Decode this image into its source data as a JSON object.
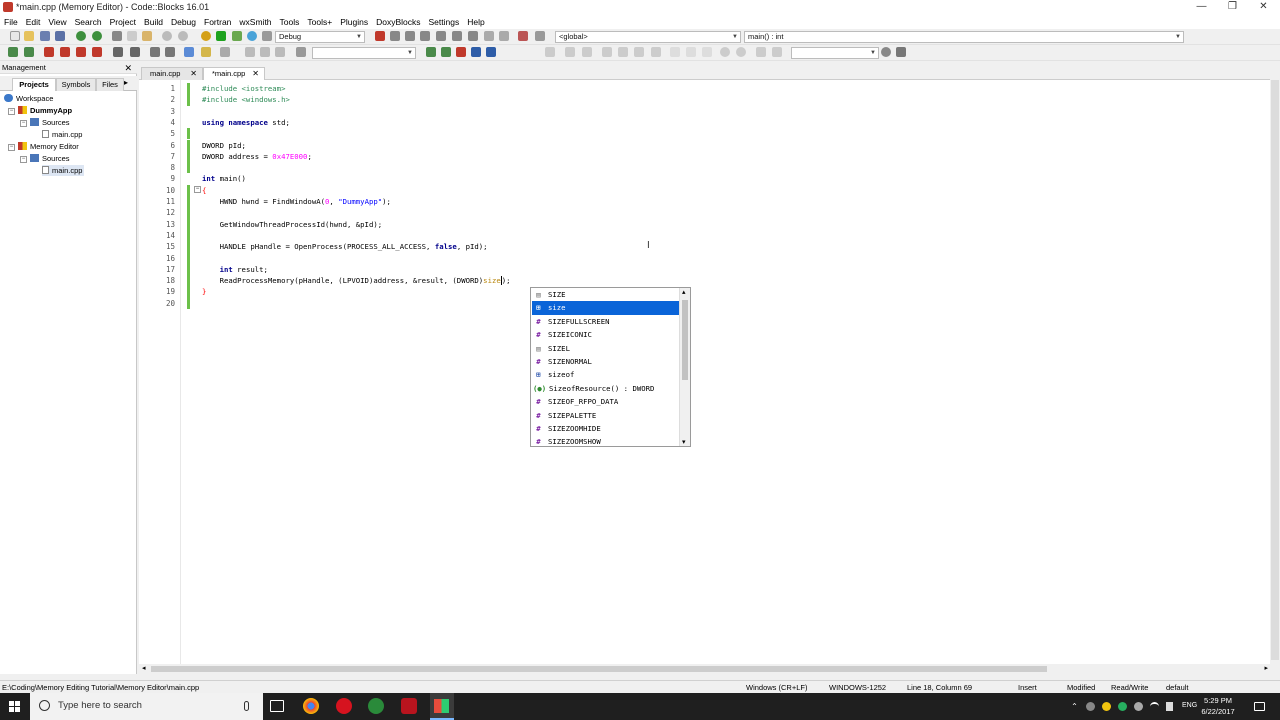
{
  "window": {
    "title": "*main.cpp (Memory Editor) - Code::Blocks 16.01",
    "min_glyph": "—",
    "max_glyph": "❐",
    "close_glyph": "✕"
  },
  "menu": [
    "File",
    "Edit",
    "View",
    "Search",
    "Project",
    "Build",
    "Debug",
    "Fortran",
    "wxSmith",
    "Tools",
    "Tools+",
    "Plugins",
    "DoxyBlocks",
    "Settings",
    "Help"
  ],
  "toolbar": {
    "build_target": "Debug",
    "scope": "<global>",
    "function": "main() : int",
    "search_value": ""
  },
  "management": {
    "title": "Management",
    "close_glyph": "✕",
    "tabs": [
      "Projects",
      "Symbols",
      "Files"
    ],
    "tab_arrow": "▸",
    "tree": {
      "workspace": "Workspace",
      "projects": [
        {
          "name": "DummyApp",
          "folder": "Sources",
          "file": "main.cpp"
        },
        {
          "name": "Memory Editor",
          "folder": "Sources",
          "file": "main.cpp"
        }
      ],
      "expander": "−"
    }
  },
  "editor_tabs": [
    {
      "label": "main.cpp",
      "close": "✕"
    },
    {
      "label": "*main.cpp",
      "close": "✕"
    }
  ],
  "code": {
    "line_numbers": [
      "1",
      "2",
      "3",
      "4",
      "5",
      "6",
      "7",
      "8",
      "9",
      "10",
      "11",
      "12",
      "13",
      "14",
      "15",
      "16",
      "17",
      "18",
      "19",
      "20"
    ],
    "fold_glyph": "−",
    "l1": "#include <iostream>",
    "l2": "#include <windows.h>",
    "l4_kw": "using namespace",
    "l4_rest": " std;",
    "l6": "DWORD pId;",
    "l7_a": "DWORD address = ",
    "l7_num": "0x47E000",
    "l7_b": ";",
    "l9_kw": "int",
    "l9_rest": " main()",
    "l10": "{",
    "l11_a": "    HWND hwnd = FindWindowA(",
    "l11_num": "0",
    "l11_b": ", ",
    "l11_str": "\"DummyApp\"",
    "l11_c": ");",
    "l13": "    GetWindowThreadProcessId(hwnd, &pId);",
    "l15_a": "    HANDLE pHandle = OpenProcess(PROCESS_ALL_ACCESS, ",
    "l15_kw": "false",
    "l15_b": ", pId);",
    "l17_kw": "    int",
    "l17_rest": " result;",
    "l18_a": "    ReadProcessMemory(pHandle, (LPVOID)address, &result, (DWORD)",
    "l18_typed": "size",
    "l18_b": ");",
    "l19": "}"
  },
  "autocomplete": [
    {
      "icon": "▤",
      "text": "SIZE"
    },
    {
      "icon": "⊞",
      "text": "size"
    },
    {
      "icon": "#",
      "text": "SIZEFULLSCREEN"
    },
    {
      "icon": "#",
      "text": "SIZEICONIC"
    },
    {
      "icon": "▤",
      "text": "SIZEL"
    },
    {
      "icon": "#",
      "text": "SIZENORMAL"
    },
    {
      "icon": "⊞",
      "text": "sizeof"
    },
    {
      "icon": "(●)",
      "text": "SizeofResource() : DWORD"
    },
    {
      "icon": "#",
      "text": "SIZEOF_RFPO_DATA"
    },
    {
      "icon": "#",
      "text": "SIZEPALETTE"
    },
    {
      "icon": "#",
      "text": "SIZEZOOMHIDE"
    },
    {
      "icon": "#",
      "text": "SIZEZOOMSHOW"
    }
  ],
  "autocomplete_up": "▴",
  "autocomplete_down": "▾",
  "status": {
    "path": "E:\\Coding\\Memory Editing Tutorial\\Memory Editor\\main.cpp",
    "eol": "Windows (CR+LF)",
    "encoding": "WINDOWS-1252",
    "position": "Line 18, Column 69",
    "mode": "Insert",
    "modified": "Modified",
    "access": "Read/Write",
    "profile": "default"
  },
  "taskbar": {
    "search_placeholder": "Type here to search",
    "lang": "ENG",
    "time": "5:29 PM",
    "date": "6/22/2017",
    "tray_up": "⌃"
  },
  "colors": {
    "accent": "#0a64d8",
    "change_bar": "#6cc04a",
    "keyword": "#00008b",
    "preproc": "#2e8b57",
    "string": "#0000ff",
    "number": "#ff00ff"
  }
}
